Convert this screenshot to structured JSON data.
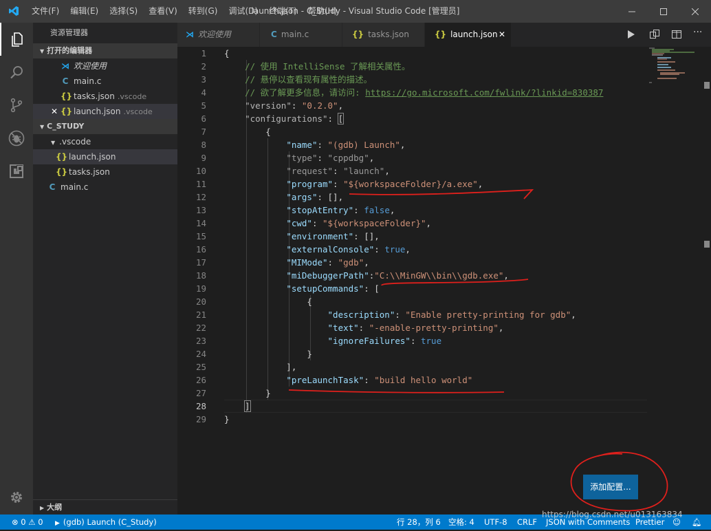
{
  "titlebar": {
    "menus": [
      "文件(F)",
      "编辑(E)",
      "选择(S)",
      "查看(V)",
      "转到(G)",
      "调试(D)",
      "终端(T)",
      "帮助(H)"
    ],
    "title": "launch.json - C_Study - Visual Studio Code [管理员]"
  },
  "activity_icons": [
    "files-icon",
    "search-icon",
    "source-control-icon",
    "debug-icon",
    "extensions-icon",
    "settings-gear-icon"
  ],
  "sidebar": {
    "title": "资源管理器",
    "open_editors_label": "打开的编辑器",
    "open_editors": [
      {
        "icon": "vscode-icon",
        "label": "欢迎使用",
        "desc": ""
      },
      {
        "icon": "c-file-icon",
        "label": "main.c",
        "desc": ""
      },
      {
        "icon": "json-icon",
        "label": "tasks.json",
        "desc": ".vscode"
      },
      {
        "icon": "json-icon",
        "label": "launch.json",
        "desc": ".vscode"
      }
    ],
    "folder_label": "C_STUDY",
    "tree": [
      {
        "label": ".vscode"
      },
      {
        "label": "launch.json"
      },
      {
        "label": "tasks.json"
      },
      {
        "label": "main.c"
      }
    ],
    "outline_label": "大纲"
  },
  "tabs": [
    {
      "icon": "vscode-icon",
      "label": "欢迎使用"
    },
    {
      "icon": "c-file-icon",
      "label": "main.c"
    },
    {
      "icon": "json-icon",
      "label": "tasks.json"
    },
    {
      "icon": "json-icon",
      "label": "launch.json",
      "active": true
    }
  ],
  "editor": {
    "line_numbers": [
      "1",
      "2",
      "3",
      "4",
      "5",
      "6",
      "7",
      "8",
      "9",
      "10",
      "11",
      "12",
      "13",
      "14",
      "15",
      "16",
      "17",
      "18",
      "19",
      "20",
      "21",
      "22",
      "23",
      "24",
      "25",
      "26",
      "27",
      "28",
      "29"
    ],
    "code": {
      "l2": "// 使用 IntelliSense 了解相关属性。",
      "l3": "// 悬停以查看现有属性的描述。",
      "l4a": "// 欲了解更多信息，请访问: ",
      "l4b": "https://go.microsoft.com/fwlink/?linkid=830387",
      "version_key": "\"version\"",
      "version_val": "\"0.2.0\"",
      "configurations_key": "\"configurations\"",
      "name_key": "\"name\"",
      "name_val": "\"(gdb) Launch\"",
      "type_key": "\"type\"",
      "type_val": "\"cppdbg\"",
      "request_key": "\"request\"",
      "request_val": "\"launch\"",
      "program_key": "\"program\"",
      "program_val": "\"${workspaceFolder}/a.exe\"",
      "args_key": "\"args\"",
      "stop_key": "\"stopAtEntry\"",
      "stop_val": "false",
      "cwd_key": "\"cwd\"",
      "cwd_val": "\"${workspaceFolder}\"",
      "env_key": "\"environment\"",
      "ext_key": "\"externalConsole\"",
      "ext_val": "true",
      "mimode_key": "\"MIMode\"",
      "mimode_val": "\"gdb\"",
      "midbg_key": "\"miDebuggerPath\"",
      "midbg_val": "\"C:\\\\MinGW\\\\bin\\\\gdb.exe\"",
      "setup_key": "\"setupCommands\"",
      "desc_key": "\"description\"",
      "desc_val": "\"Enable pretty-printing for gdb\"",
      "text_key": "\"text\"",
      "text_val": "\"-enable-pretty-printing\"",
      "ignore_key": "\"ignoreFailures\"",
      "ignore_val": "true",
      "prelaunch_key": "\"preLaunchTask\"",
      "prelaunch_val": "\"build hello world\""
    },
    "add_config_button": "添加配置..."
  },
  "statusbar": {
    "problems": "⊗ 0 ⚠ 0",
    "launch": "(gdb) Launch (C_Study)",
    "position": "行 28，列 6",
    "spaces": "空格: 4",
    "encoding": "UTF-8",
    "eol": "CRLF",
    "language": "JSON with Comments",
    "prettier": "Prettier"
  },
  "watermark": "https://blog.csdn.net/u013163834",
  "colors": {
    "accent": "#007acc",
    "button": "#0e639c",
    "annotation": "#e0201c"
  }
}
